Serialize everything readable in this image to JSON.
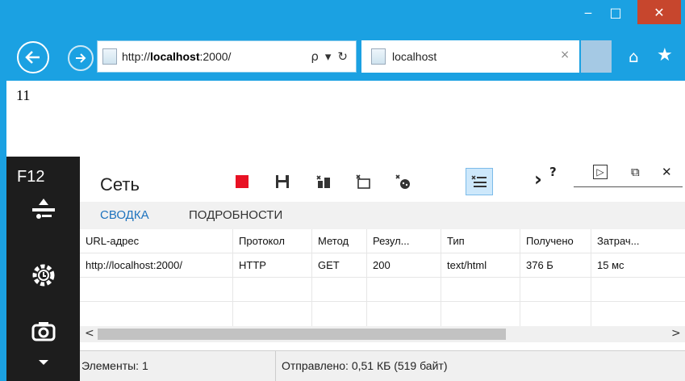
{
  "window": {
    "minimize_glyph": "‒",
    "maximize_glyph": "□",
    "close_glyph": "✕"
  },
  "navigation": {
    "address_prefix": "http://",
    "address_host": "localhost",
    "address_suffix": ":2000/",
    "search_glyph": "ρ",
    "dropdown_glyph": "▾",
    "refresh_glyph": "↻",
    "tab_title": "localhost",
    "tab_close_glyph": "×",
    "home_glyph": "⌂",
    "favorites_glyph": "★",
    "back_glyph": "←",
    "forward_glyph": "→"
  },
  "page": {
    "body_text": "11"
  },
  "devtools": {
    "f12_label": "F12",
    "tool_title": "Сеть",
    "subtabs": [
      "СВОДКА",
      "ПОДРОБНОСТИ"
    ],
    "columns": [
      "URL-адрес",
      "Протокол",
      "Метод",
      "Резул...",
      "Тип",
      "Получено",
      "Затрач..."
    ],
    "rows": [
      [
        "http://localhost:2000/",
        "HTTP",
        "GET",
        "200",
        "text/html",
        "376 Б",
        "15 мс"
      ]
    ],
    "status_items": "Элементы: 1",
    "status_sent": "Отправлено: 0,51 КБ (519 байт)",
    "help_glyph": "?",
    "console_glyph": "▷",
    "undock_glyph": "⧉",
    "close_glyph": "✕",
    "more_glyph": "›",
    "scroll_left_glyph": "<",
    "scroll_right_glyph": ">",
    "icons": [
      "record-icon",
      "save-icon",
      "clear-icon",
      "clear-on-navigate-icon",
      "clear-cache-icon",
      "filter-icon"
    ]
  }
}
